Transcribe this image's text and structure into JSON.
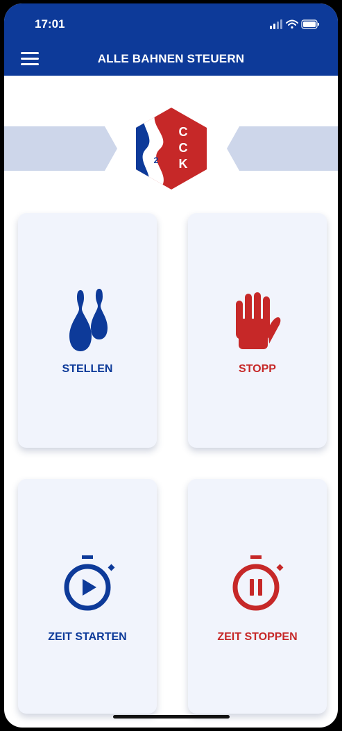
{
  "status_bar": {
    "time": "17:01"
  },
  "header": {
    "title": "ALLE BAHNEN STEUERN"
  },
  "logo": {
    "letters": [
      "C",
      "C",
      "K"
    ],
    "number": "2"
  },
  "colors": {
    "primary_blue": "#0d3a99",
    "red": "#c62828",
    "card_bg": "#f1f4fc"
  },
  "actions": [
    {
      "label": "STELLEN",
      "icon": "bowling-pins-icon"
    },
    {
      "label": "STOPP",
      "icon": "stop-hand-icon"
    },
    {
      "label": "ZEIT STARTEN",
      "icon": "stopwatch-play-icon"
    },
    {
      "label": "ZEIT STOPPEN",
      "icon": "stopwatch-pause-icon"
    }
  ]
}
